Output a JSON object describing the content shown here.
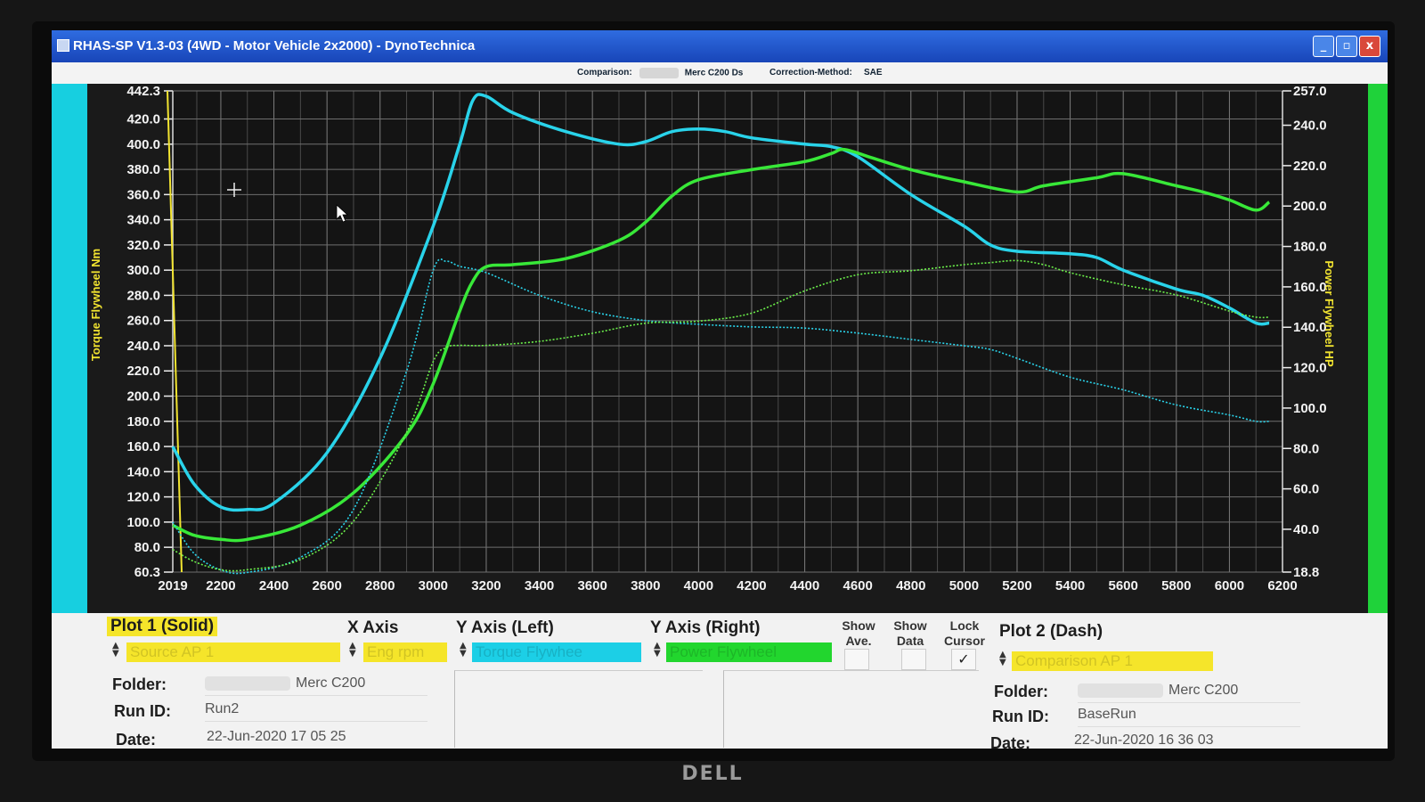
{
  "window": {
    "title": "RHAS-SP V1.3-03  (4WD - Motor Vehicle 2x2000) - DynoTechnica",
    "buttons": {
      "minimize": "_",
      "maximize": "▫",
      "close": "x"
    }
  },
  "infobar": {
    "comparison_label": "Comparison:",
    "comparison_value": "Merc C200 Ds",
    "correction_label": "Correction-Method:",
    "correction_value": "SAE"
  },
  "chart_data": {
    "type": "line",
    "title": "",
    "xlabel": "",
    "ylabel_left": "Torque Flywheel Nm",
    "ylabel_right": "Power Flywheel HP",
    "x_ticks": [
      "2019",
      "2200",
      "2400",
      "2600",
      "2800",
      "3000",
      "3200",
      "3400",
      "3600",
      "3800",
      "4000",
      "4200",
      "4400",
      "4600",
      "4800",
      "5000",
      "5200",
      "5400",
      "5600",
      "5800",
      "6000",
      "6200"
    ],
    "y_left_ticks": [
      "442.3",
      "420.0",
      "400.0",
      "380.0",
      "360.0",
      "340.0",
      "320.0",
      "300.0",
      "280.0",
      "260.0",
      "240.0",
      "220.0",
      "200.0",
      "180.0",
      "160.0",
      "140.0",
      "120.0",
      "100.0",
      "80.0",
      "60.3"
    ],
    "y_right_ticks": [
      "257.0",
      "240.0",
      "220.0",
      "200.0",
      "180.0",
      "160.0",
      "140.0",
      "120.0",
      "100.0",
      "80.0",
      "60.0",
      "40.0",
      "18.8"
    ],
    "ylim_left": [
      60.3,
      442.3
    ],
    "ylim_right": [
      18.8,
      257.0
    ],
    "xlim": [
      2019,
      6200
    ],
    "grid": true,
    "cursor_x": 2019,
    "series": [
      {
        "name": "Torque Flywheel",
        "plot": "Plot 1",
        "style": "solid",
        "axis": "left",
        "color": "#29d3ea",
        "x": [
          2019,
          2100,
          2200,
          2300,
          2400,
          2600,
          2800,
          3000,
          3100,
          3150,
          3200,
          3300,
          3500,
          3700,
          3800,
          3900,
          4000,
          4100,
          4200,
          4400,
          4500,
          4600,
          4800,
          5000,
          5100,
          5200,
          5400,
          5500,
          5600,
          5800,
          5900,
          6000,
          6100,
          6150
        ],
        "y": [
          160,
          130,
          112,
          110,
          115,
          155,
          230,
          335,
          400,
          435,
          438,
          425,
          410,
          400,
          402,
          410,
          412,
          410,
          405,
          400,
          398,
          390,
          360,
          335,
          320,
          315,
          313,
          310,
          300,
          285,
          280,
          270,
          258,
          258
        ]
      },
      {
        "name": "Power Flywheel",
        "plot": "Plot 1",
        "style": "solid",
        "axis": "right",
        "color": "#38e838",
        "x": [
          2019,
          2100,
          2200,
          2300,
          2500,
          2700,
          2900,
          3000,
          3100,
          3150,
          3200,
          3300,
          3500,
          3700,
          3800,
          3900,
          4000,
          4200,
          4400,
          4500,
          4550,
          4650,
          4800,
          5000,
          5200,
          5300,
          5500,
          5600,
          5800,
          5900,
          6000,
          6100,
          6150
        ],
        "y": [
          42,
          37,
          35,
          35,
          42,
          58,
          87,
          112,
          148,
          163,
          170,
          171,
          174,
          183,
          192,
          205,
          213,
          218,
          222,
          226,
          228,
          224,
          218,
          212,
          207,
          210,
          214,
          216,
          210,
          207,
          203,
          198,
          202
        ]
      },
      {
        "name": "Torque Flywheel",
        "plot": "Plot 2",
        "style": "dash",
        "axis": "left",
        "color": "#29d3ea",
        "x": [
          2019,
          2100,
          2200,
          2300,
          2500,
          2700,
          2900,
          3000,
          3050,
          3100,
          3200,
          3400,
          3600,
          3800,
          4000,
          4200,
          4400,
          4600,
          4800,
          5000,
          5100,
          5200,
          5400,
          5600,
          5800,
          6000,
          6100,
          6150
        ],
        "y": [
          100,
          75,
          62,
          60,
          72,
          110,
          220,
          300,
          307,
          303,
          298,
          280,
          267,
          260,
          257,
          255,
          254,
          250,
          245,
          240,
          237,
          230,
          215,
          205,
          193,
          185,
          180,
          180
        ]
      },
      {
        "name": "Power Flywheel",
        "plot": "Plot 2",
        "style": "dash",
        "axis": "right",
        "color": "#6bef4a",
        "x": [
          2019,
          2100,
          2200,
          2300,
          2500,
          2700,
          2900,
          3000,
          3050,
          3100,
          3200,
          3400,
          3600,
          3800,
          4000,
          4200,
          4400,
          4600,
          4800,
          5000,
          5100,
          5200,
          5300,
          5400,
          5600,
          5800,
          6000,
          6100,
          6150
        ],
        "y": [
          30,
          24,
          20,
          20,
          25,
          44,
          88,
          123,
          130,
          131,
          131,
          133,
          137,
          142,
          143,
          147,
          158,
          166,
          168,
          171,
          172,
          173,
          171,
          167,
          161,
          156,
          148,
          145,
          145
        ]
      }
    ]
  },
  "panel": {
    "plot1_title": "Plot 1 (Solid)",
    "x_axis_title": "X Axis",
    "y_left_title": "Y Axis (Left)",
    "y_right_title": "Y Axis (Right)",
    "show_ave": "Show Ave.",
    "show_data": "Show Data",
    "lock_cursor": "Lock Cursor",
    "lock_cursor_checked": "✓",
    "plot2_title": "Plot 2 (Dash)",
    "source_select": "Source AP 1",
    "xaxis_select": "Eng rpm",
    "yleft_select": "Torque Flywhee",
    "yright_select": "Power Flywheel",
    "comparison_select": "Comparison AP 1",
    "folder_label": "Folder:",
    "runid_label": "Run ID:",
    "date_label": "Date:",
    "plot1_folder": "Merc C200",
    "plot1_runid": "Run2",
    "plot1_date": "22-Jun-2020  17 05 25",
    "plot2_folder": "Merc C200",
    "plot2_runid": "BaseRun",
    "plot2_date": "22-Jun-2020  16 36 03",
    "colors": {
      "yellow": "#f5e52a",
      "cyan": "#1ccfe6",
      "green": "#22d62e"
    }
  }
}
